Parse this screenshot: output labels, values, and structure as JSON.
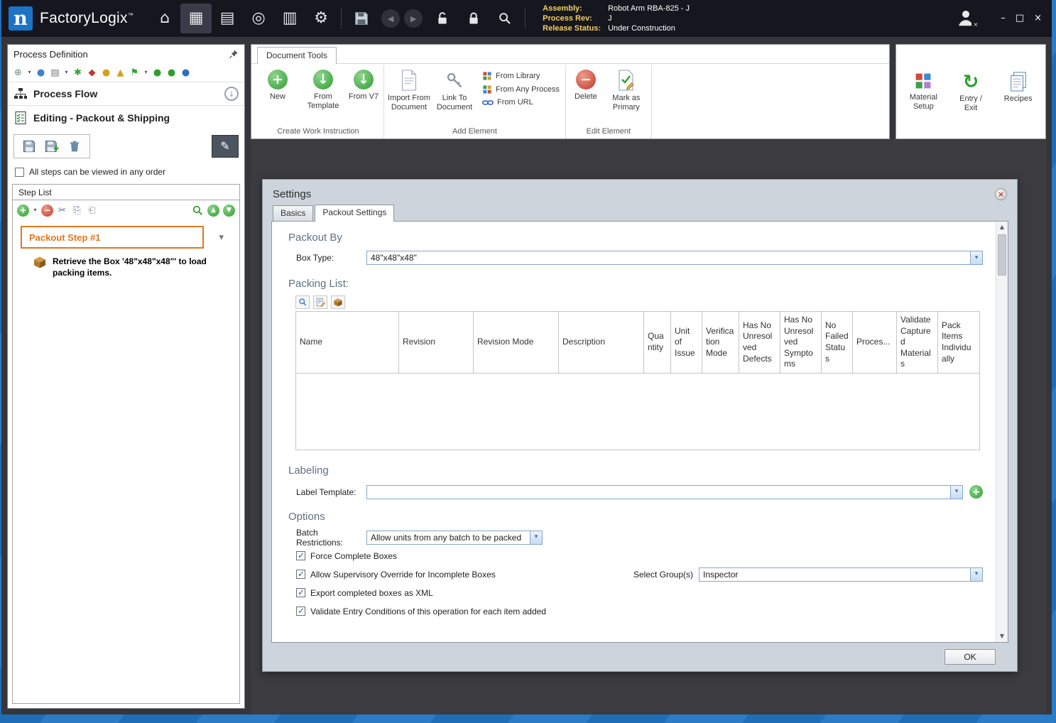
{
  "icons": {
    "home": "⌂",
    "process_grid": "▦",
    "documents": "▤",
    "navigate": "◎",
    "news": "▥",
    "gear": "⚙",
    "back": "◀",
    "forward": "▶",
    "minimize": "–",
    "maximize": "□",
    "close": "×",
    "plus": "+",
    "minus": "−",
    "down_arrow": "↓",
    "caret_down": "▾",
    "chevron_down": "▾",
    "refresh": "↻",
    "scissors": "✂",
    "copy": "⎘",
    "paste": "⎗",
    "pencil": "✎",
    "asterisk": "✱",
    "flag": "⚑",
    "dot": "●",
    "diamond": "◆",
    "triangle_up": "▲",
    "scroll_up": "▲",
    "scroll_down": "▼"
  },
  "titlebar": {
    "logo_letter": "n",
    "app_name": "FactoryLogix",
    "trademark": "™",
    "info": {
      "assembly_label": "Assembly:",
      "assembly_value": "Robot Arm RBA-825 - J",
      "process_rev_label": "Process Rev:",
      "process_rev_value": "J",
      "release_status_label": "Release Status:",
      "release_status_value": "Under Construction"
    }
  },
  "sidebar": {
    "title": "Process Definition",
    "process_flow_label": "Process Flow",
    "editing_label": "Editing - Packout & Shipping",
    "order_checkbox_label": "All steps can be viewed in any order",
    "step_list": {
      "title": "Step List",
      "step_name": "Packout Step #1",
      "step_description": "Retrieve the Box '48\"x48\"x48\"' to load packing items."
    }
  },
  "ribbon": {
    "tab_label": "Document Tools",
    "create_group": {
      "label": "Create Work Instruction",
      "new": "New",
      "from_template": "From Template",
      "from_v7": "From V7"
    },
    "add_group": {
      "label": "Add Element",
      "import_from_document": "Import From Document",
      "link_to_document": "Link To Document",
      "from_library": "From Library",
      "from_any_process": "From Any Process",
      "from_url": "From URL"
    },
    "edit_group": {
      "label": "Edit Element",
      "delete": "Delete",
      "mark_as_primary": "Mark as Primary"
    },
    "right_group": {
      "material_setup": "Material Setup",
      "entry_exit": "Entry / Exit",
      "recipes": "Recipes"
    }
  },
  "dialog": {
    "title": "Settings",
    "tabs": [
      "Basics",
      "Packout Settings"
    ],
    "packout_by": {
      "heading": "Packout By",
      "box_type_label": "Box Type:",
      "box_type_value": "48\"x48\"x48\""
    },
    "packing_list": {
      "heading": "Packing List:",
      "columns": [
        "Name",
        "Revision",
        "Revision Mode",
        "Description",
        "Quantity",
        "Unit of Issue",
        "Verification Mode",
        "Has No Unresolved Defects",
        "Has No Unresolved Symptoms",
        "No Failed Status",
        "Proces...",
        "Validate Captured Materials",
        "Pack Items Individually"
      ]
    },
    "labeling": {
      "heading": "Labeling",
      "label_template_label": "Label Template:",
      "label_template_value": ""
    },
    "options": {
      "heading": "Options",
      "batch_restrictions_label": "Batch Restrictions:",
      "batch_restrictions_value": "Allow units from any batch to be packed",
      "checkboxes": [
        "Force Complete Boxes",
        "Allow Supervisory Override for Incomplete Boxes",
        "Export completed boxes as XML",
        "Validate Entry Conditions of this operation for each item added"
      ],
      "select_group_label": "Select Group(s)",
      "select_group_value": "Inspector"
    },
    "ok_button": "OK"
  }
}
